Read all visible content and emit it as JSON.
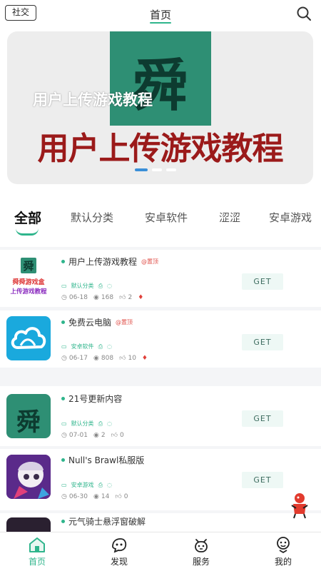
{
  "header": {
    "social_label": "社交",
    "title": "首页"
  },
  "banner": {
    "logo_glyph": "舜",
    "small_text": "用户上传游戏教程",
    "big_text": "用户上传游戏教程",
    "slide_count": 3,
    "active_slide": 1
  },
  "tabs": [
    {
      "label": "全部",
      "active": true
    },
    {
      "label": "默认分类"
    },
    {
      "label": "安卓软件"
    },
    {
      "label": "涩涩"
    },
    {
      "label": "安卓游戏"
    }
  ],
  "items": [
    {
      "title": "用户上传游戏教程",
      "tag": "@置顶",
      "category": "默认分类",
      "date": "06-18",
      "views": "168",
      "likes": "2",
      "hot": true,
      "get_label": "GET",
      "thumb_text_1": "舜舜游戏盒",
      "thumb_text_2": "上传游戏教程"
    },
    {
      "title": "免费云电脑",
      "tag": "@置顶",
      "category": "安卓软件",
      "date": "06-17",
      "views": "808",
      "likes": "10",
      "hot": true,
      "get_label": "GET"
    },
    {
      "title": "21号更新内容",
      "category": "默认分类",
      "date": "07-01",
      "views": "2",
      "likes": "0",
      "hot": false,
      "get_label": "GET"
    },
    {
      "title": "Null's Brawl私服版",
      "category": "安卓游戏",
      "date": "06-30",
      "views": "14",
      "likes": "0",
      "hot": false,
      "get_label": "GET"
    },
    {
      "title": "元气骑士悬浮窗破解"
    }
  ],
  "bottom_nav": [
    {
      "label": "首页",
      "icon": "home-icon",
      "active": true
    },
    {
      "label": "发现",
      "icon": "discover-icon"
    },
    {
      "label": "服务",
      "icon": "service-icon"
    },
    {
      "label": "我的",
      "icon": "profile-icon"
    }
  ],
  "colors": {
    "accent": "#2fb58c",
    "banner_red": "#9b1a1a",
    "logo_green": "#2e8f74"
  }
}
